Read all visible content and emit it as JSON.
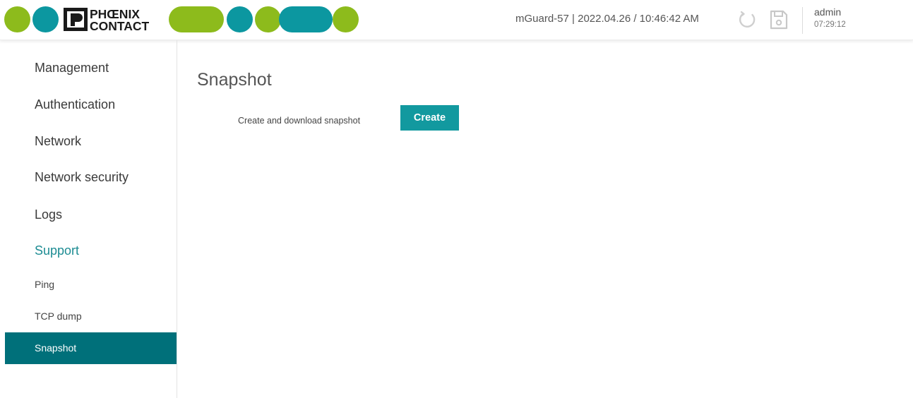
{
  "header": {
    "logo_text_line1": "PHŒNIX",
    "logo_text_line2": "CONTACT",
    "device_info": "mGuard-57 | 2022.04.26 / 10:46:42 AM",
    "reload_icon": "reload-icon",
    "save_icon": "save-icon",
    "user": "admin",
    "session_timer": "07:29:12"
  },
  "brand_colors": {
    "teal": "#0c97a0",
    "green": "#8dbb1c",
    "active_nav": "#1d8c93",
    "selected_bg": "#00707a",
    "button": "#12999f"
  },
  "sidebar": {
    "items": [
      {
        "label": "Management"
      },
      {
        "label": "Authentication"
      },
      {
        "label": "Network"
      },
      {
        "label": "Network security"
      },
      {
        "label": "Logs"
      },
      {
        "label": "Support"
      }
    ],
    "subitems": [
      {
        "label": "Ping"
      },
      {
        "label": "TCP dump"
      },
      {
        "label": "Snapshot"
      }
    ]
  },
  "main": {
    "title": "Snapshot",
    "field_label": "Create and download snapshot",
    "create_button": "Create"
  }
}
